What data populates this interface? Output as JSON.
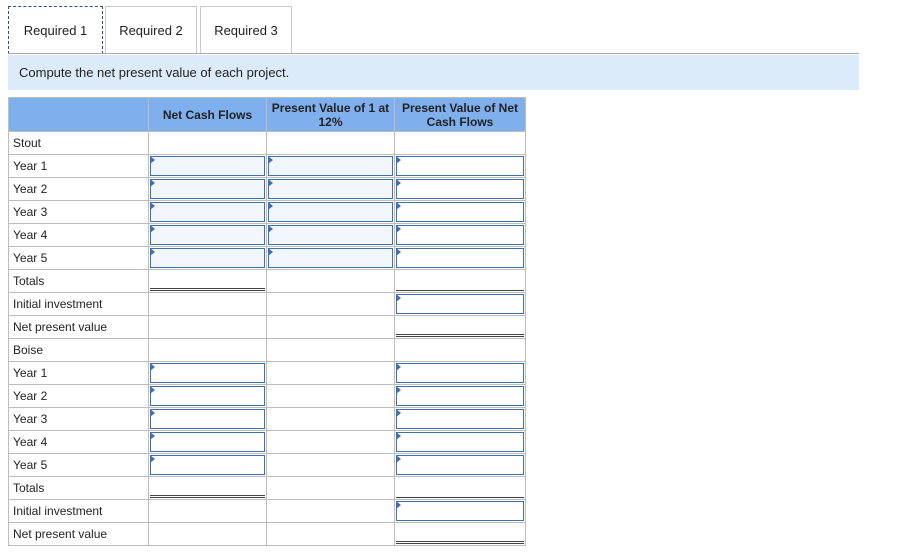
{
  "tabs": [
    {
      "label": "Required 1",
      "active": true
    },
    {
      "label": "Required 2",
      "active": false
    },
    {
      "label": "Required 3",
      "active": false
    }
  ],
  "instruction": "Compute the net present value of each project.",
  "table": {
    "headers": {
      "col1": "Net Cash Flows",
      "col2": "Present Value of 1 at 12%",
      "col3": "Present Value of Net Cash Flows"
    },
    "stout": {
      "title": "Stout",
      "years": [
        "Year 1",
        "Year 2",
        "Year 3",
        "Year 4",
        "Year 5"
      ],
      "totals": "Totals",
      "initial_investment": "Initial investment",
      "net_present_value": "Net present value"
    },
    "boise": {
      "title": "Boise",
      "years": [
        "Year 1",
        "Year 2",
        "Year 3",
        "Year 4",
        "Year 5"
      ],
      "totals": "Totals",
      "initial_investment": "Initial investment",
      "net_present_value": "Net present value"
    }
  },
  "colors": {
    "header_bg": "#7fb0ed",
    "instruction_bg": "#dcebfa",
    "input_border": "#3e6fb0"
  }
}
